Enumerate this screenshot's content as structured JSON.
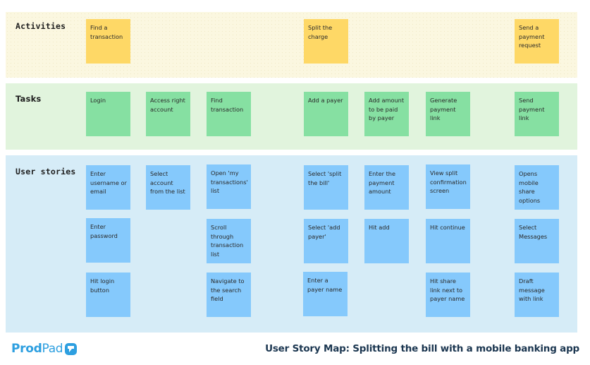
{
  "bands": {
    "activities": {
      "label": "Activities",
      "notes": [
        "Find a transaction",
        "Split the charge",
        "Send a payment request"
      ]
    },
    "tasks": {
      "label": "Tasks",
      "notes": [
        "Login",
        "Access right account",
        "Find transaction",
        "Add a payer",
        "Add amount to be paid by payer",
        "Generate payment link",
        "Send payment link"
      ]
    },
    "user_stories": {
      "label": "User stories",
      "row1": [
        "Enter username or email",
        "Select account from the list",
        "Open 'my transactions' list",
        "Select 'split the bill'",
        "Enter the payment amount",
        "View split confirmation screen",
        "Opens mobile share options"
      ],
      "row2": [
        "Enter password",
        "Scroll through transaction list",
        "Select 'add payer'",
        "Hit add",
        "Hit continue",
        "Select Messages"
      ],
      "row3": [
        "Hit login button",
        "Navigate to the search field",
        "Enter a payer name",
        "Hit share link next to payer name",
        "Draft message with link"
      ]
    }
  },
  "colors": {
    "activity_note": "#fed866",
    "task_note": "#86e0a2",
    "story_note": "#85c9fc",
    "brand": "#2d9fe0"
  },
  "footer": {
    "logo_prod": "Prod",
    "logo_pad": "Pad",
    "logo_icon": "prodpad-logo-icon",
    "title": "User Story Map: Splitting the bill with a mobile banking app"
  }
}
